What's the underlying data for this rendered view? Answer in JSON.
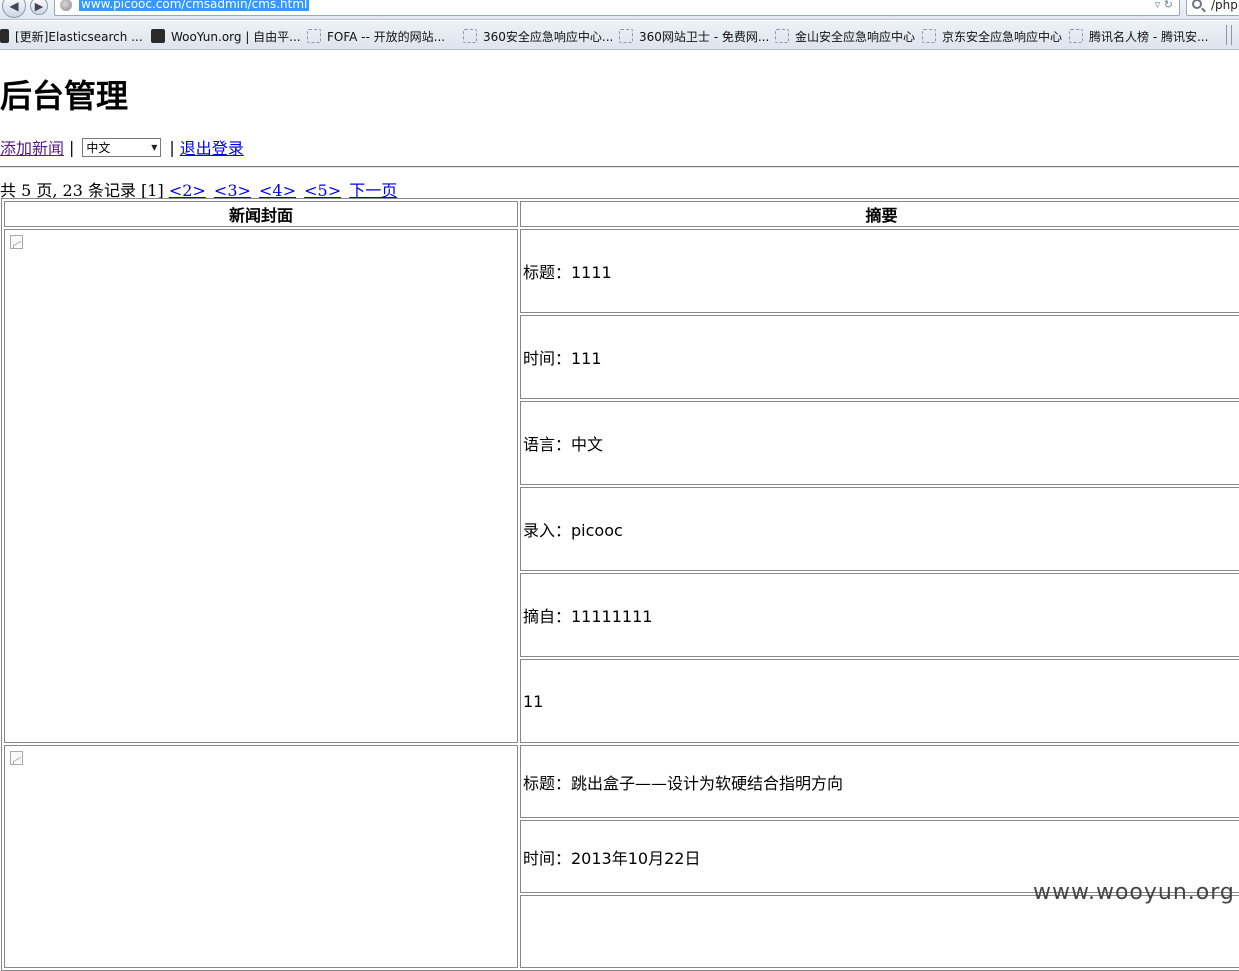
{
  "browser": {
    "url": "www.picooc.com/cmsadmin/cms.html",
    "search_text": "/php",
    "bookmarks": [
      {
        "label": "[更新]Elasticsearch ..."
      },
      {
        "label": "WooYun.org | 自由平..."
      },
      {
        "label": "FOFA -- 开放的网站..."
      },
      {
        "label": "360安全应急响应中心..."
      },
      {
        "label": "360网站卫士 - 免费网..."
      },
      {
        "label": "金山安全应急响应中心"
      },
      {
        "label": "京东安全应急响应中心"
      },
      {
        "label": "腾讯名人榜 - 腾讯安..."
      }
    ]
  },
  "page": {
    "title": "后台管理",
    "toolbar": {
      "add_news": "添加新闻",
      "separator": "|",
      "language_selected": "中文",
      "logout": "退出登录"
    },
    "pager": {
      "summary": "共 5 页, 23 条记录 [1]",
      "pages": [
        "<2>",
        "<3>",
        "<4>",
        "<5>"
      ],
      "next": "下一页"
    },
    "table": {
      "headers": {
        "cover": "新闻封面",
        "summary": "摘要"
      },
      "records": [
        {
          "fields": [
            "标题：1111",
            "时间：111",
            "语言：中文",
            "录入：picooc",
            "摘自：11111111",
            "11"
          ]
        },
        {
          "fields": [
            "标题：跳出盒子——设计为软硬结合指明方向",
            "时间：2013年10月22日",
            ""
          ]
        }
      ]
    }
  },
  "watermark": "www.wooyun.org"
}
